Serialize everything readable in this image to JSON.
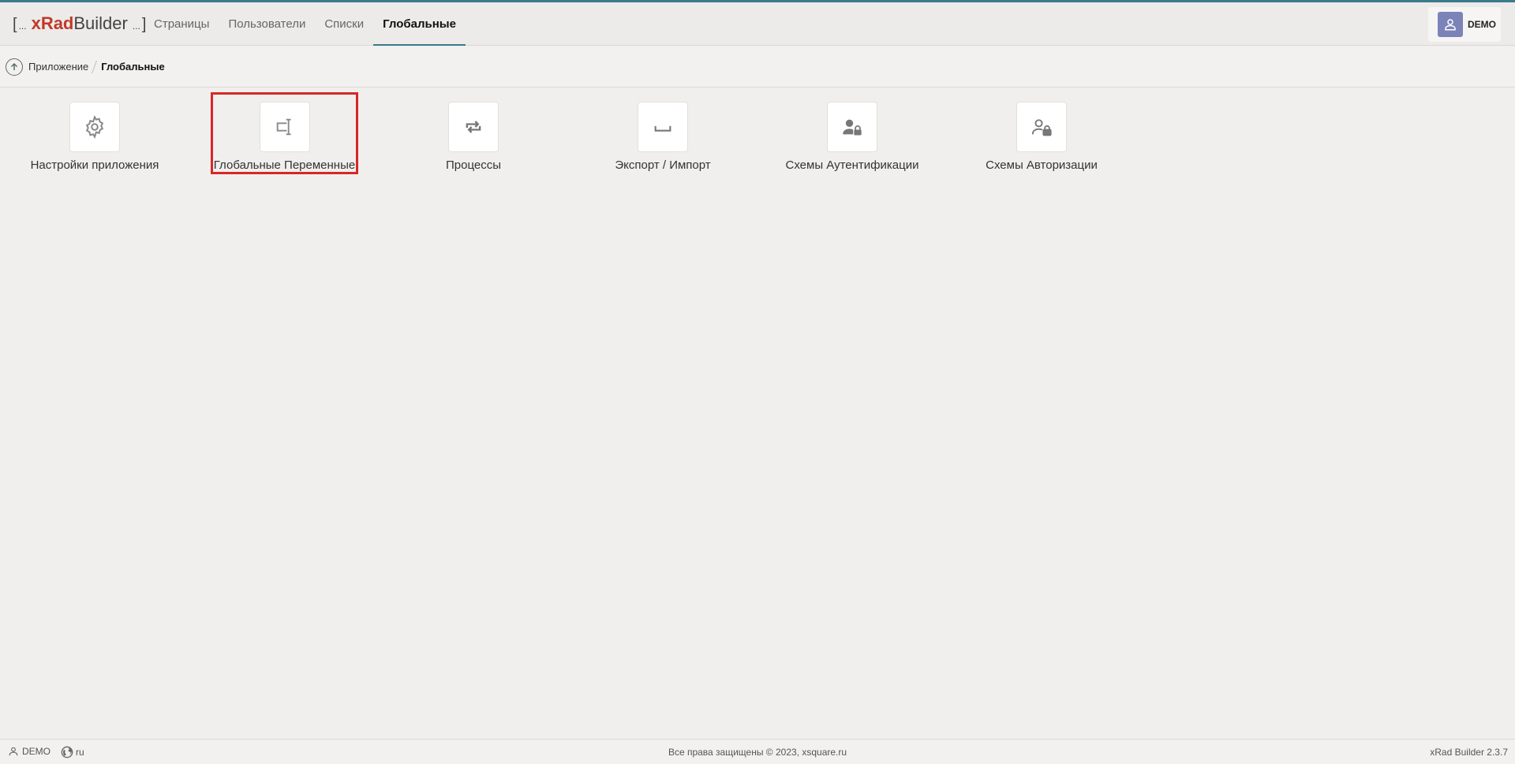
{
  "brand": {
    "bracket_open": "[",
    "dots_left": "...",
    "name_accent": "xRad",
    "name_rest": "Builder",
    "dots_right": "...",
    "bracket_close": "]"
  },
  "nav": {
    "items": [
      {
        "label": "Страницы"
      },
      {
        "label": "Пользователи"
      },
      {
        "label": "Списки"
      },
      {
        "label": "Глобальные",
        "active": true
      }
    ]
  },
  "user": {
    "name": "DEMO",
    "avatar_color": "#7b83b8"
  },
  "breadcrumb": {
    "parent": "Приложение",
    "current": "Глобальные"
  },
  "tiles": [
    {
      "label": "Настройки приложения",
      "icon": "gear-icon"
    },
    {
      "label": "Глобальные Переменные",
      "icon": "text-variable-icon",
      "selected": true
    },
    {
      "label": "Процессы",
      "icon": "repeat-icon"
    },
    {
      "label": "Экспорт / Импорт",
      "icon": "space-bar-icon"
    },
    {
      "label": "Схемы Аутентификации",
      "icon": "user-lock-filled-icon"
    },
    {
      "label": "Схемы Авторизации",
      "icon": "user-lock-outline-icon"
    }
  ],
  "footer": {
    "user": "DEMO",
    "lang": "ru",
    "copyright": "Все права защищены © 2023, xsquare.ru",
    "version": "xRad Builder 2.3.7"
  },
  "colors": {
    "accent": "#3b7a8c",
    "brand_red": "#c0392b",
    "selection": "#d62828"
  }
}
